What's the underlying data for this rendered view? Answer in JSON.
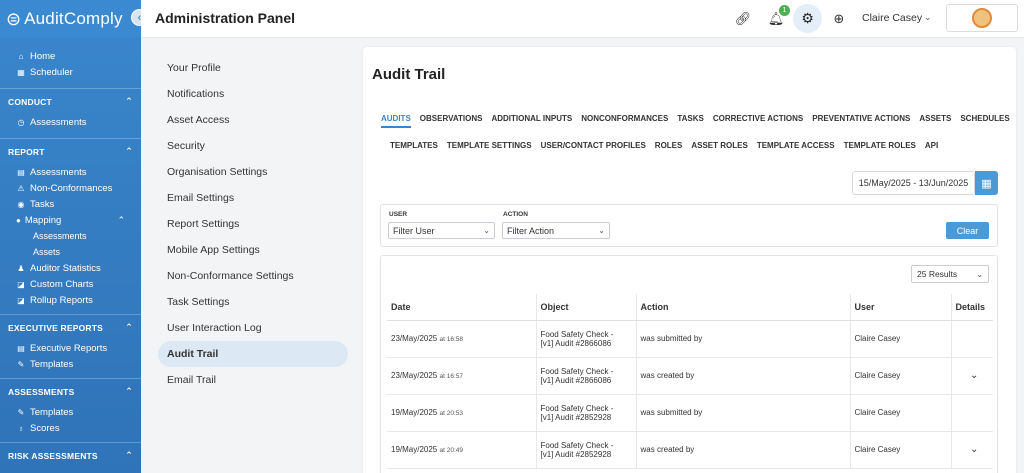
{
  "sidebar": {
    "logo": "AuditComply",
    "top_items": [
      {
        "label": "Home",
        "icon": "home-icon"
      },
      {
        "label": "Scheduler",
        "icon": "calendar-icon"
      }
    ],
    "conduct": {
      "title": "CONDUCT",
      "items": [
        {
          "label": "Assessments"
        }
      ]
    },
    "report": {
      "title": "REPORT",
      "items": [
        "Assessments",
        "Non-Conformances",
        "Tasks",
        "Mapping"
      ],
      "mapping_sub": [
        "Assessments",
        "Assets"
      ],
      "items2": [
        "Auditor Statistics",
        "Custom Charts",
        "Rollup Reports"
      ]
    },
    "executive": {
      "title": "EXECUTIVE REPORTS",
      "items": [
        "Executive Reports",
        "Templates"
      ]
    },
    "assessments": {
      "title": "ASSESSMENTS",
      "items": [
        "Templates",
        "Scores"
      ]
    },
    "risk": {
      "title": "RISK ASSESSMENTS"
    }
  },
  "header": {
    "title": "Administration Panel",
    "notification_count": "1",
    "user_name": "Claire Casey"
  },
  "settings_menu": [
    "Your Profile",
    "Notifications",
    "Asset Access",
    "Security",
    "Organisation Settings",
    "Email Settings",
    "Report Settings",
    "Mobile App Settings",
    "Non-Conformance Settings",
    "Task Settings",
    "User Interaction Log",
    "Audit Trail",
    "Email Trail"
  ],
  "main": {
    "title": "Audit Trail",
    "tabs_row1": [
      "AUDITS",
      "OBSERVATIONS",
      "ADDITIONAL INPUTS",
      "NONCONFORMANCES",
      "TASKS",
      "CORRECTIVE ACTIONS",
      "PREVENTATIVE ACTIONS",
      "ASSETS",
      "SCHEDULES"
    ],
    "tabs_row2": [
      "TEMPLATES",
      "TEMPLATE SETTINGS",
      "USER/CONTACT PROFILES",
      "ROLES",
      "ASSET ROLES",
      "TEMPLATE ACCESS",
      "TEMPLATE ROLES",
      "API"
    ],
    "date_range": "15/May/2025 - 13/Jun/2025",
    "filter": {
      "user_label": "USER",
      "user_value": "Filter User",
      "action_label": "ACTION",
      "action_value": "Filter Action",
      "clear_label": "Clear"
    },
    "results_select": "25 Results",
    "table": {
      "headers": [
        "Date",
        "Object",
        "Action",
        "User",
        "Details"
      ],
      "rows": [
        {
          "date": "23/May/2025",
          "time": "at 16:58",
          "object1": "Food Safety Check -",
          "object2": "[v1] Audit #2866086",
          "action": "was submitted by",
          "user": "Claire Casey",
          "details": ""
        },
        {
          "date": "23/May/2025",
          "time": "at 16:57",
          "object1": "Food Safety Check -",
          "object2": "[v1] Audit #2866086",
          "action": "was created by",
          "user": "Claire Casey",
          "details": "⌄"
        },
        {
          "date": "19/May/2025",
          "time": "at 20:53",
          "object1": "Food Safety Check -",
          "object2": "[v1] Audit #2852928",
          "action": "was submitted by",
          "user": "Claire Casey",
          "details": ""
        },
        {
          "date": "19/May/2025",
          "time": "at 20:49",
          "object1": "Food Safety Check -",
          "object2": "[v1] Audit #2852928",
          "action": "was created by",
          "user": "Claire Casey",
          "details": "⌄"
        }
      ]
    }
  }
}
